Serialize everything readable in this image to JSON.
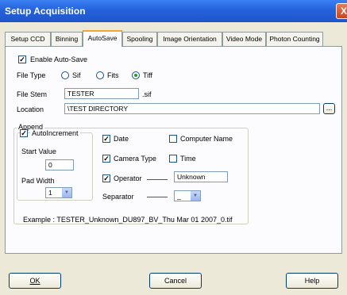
{
  "window": {
    "title": "Setup Acquisition",
    "close_glyph": "X"
  },
  "tabs": [
    "Setup CCD",
    "Binning",
    "AutoSave",
    "Spooling",
    "Image Orientation",
    "Video Mode",
    "Photon Counting"
  ],
  "autosave": {
    "enable_label": "Enable Auto-Save",
    "enable_checked": true,
    "file_type_label": "File Type",
    "file_types": [
      "Sif",
      "Fits",
      "Tiff"
    ],
    "file_type_selected": "Tiff",
    "file_stem_label": "File Stem",
    "file_stem_value": "TESTER",
    "file_stem_ext": ".sif",
    "location_label": "Location",
    "location_value": "\\TEST DIRECTORY",
    "browse_label": "...",
    "append_label": "Append",
    "autoincrement_label": "AutoIncrement",
    "start_value_label": "Start Value",
    "start_value": "0",
    "pad_width_label": "Pad Width",
    "pad_width_value": "1",
    "date_label": "Date",
    "camera_type_label": "Camera Type",
    "operator_label": "Operator",
    "operator_value": "Unknown",
    "computer_name_label": "Computer Name",
    "time_label": "Time",
    "separator_label": "Separator",
    "separator_value": "_",
    "example_text": "Example : TESTER_Unknown_DU897_BV_Thu Mar 01 2007_0.tif"
  },
  "buttons": {
    "ok": "OK",
    "cancel": "Cancel",
    "help": "Help"
  }
}
